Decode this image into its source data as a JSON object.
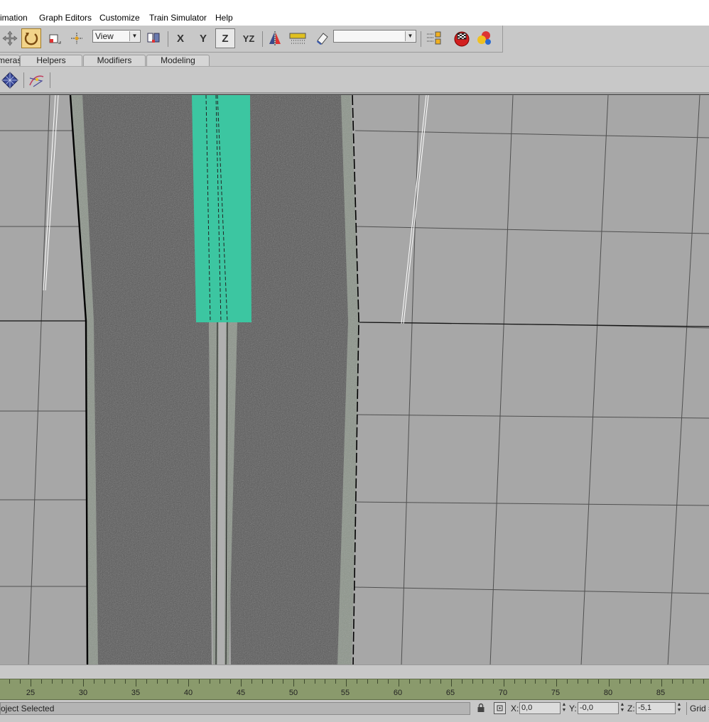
{
  "menu": {
    "items": [
      "imation",
      "Graph Editors",
      "Customize",
      "Train Simulator",
      "Help"
    ]
  },
  "toolbar": {
    "view_select": "View",
    "axis_x": "X",
    "axis_y": "Y",
    "axis_z": "Z",
    "axis_yz": "YZ",
    "selection_set": ""
  },
  "tabs": [
    "meras",
    "Helpers",
    "Modifiers",
    "Modeling"
  ],
  "viewport": {
    "background": "#a7a7a7",
    "road_color": "#595959",
    "curb_color": "#8d958b",
    "selected_color": "#3cc6a1"
  },
  "timeline": {
    "labels": [
      "25",
      "30",
      "35",
      "40",
      "45",
      "50",
      "55",
      "60",
      "65",
      "70",
      "75",
      "80",
      "85"
    ]
  },
  "status": {
    "selection": "oject Selected",
    "x_label": "X:",
    "x_value": "0,0",
    "y_label": "Y:",
    "y_value": "-0,0",
    "z_label": "Z:",
    "z_value": "-5,1",
    "grid_label": "Grid ="
  }
}
